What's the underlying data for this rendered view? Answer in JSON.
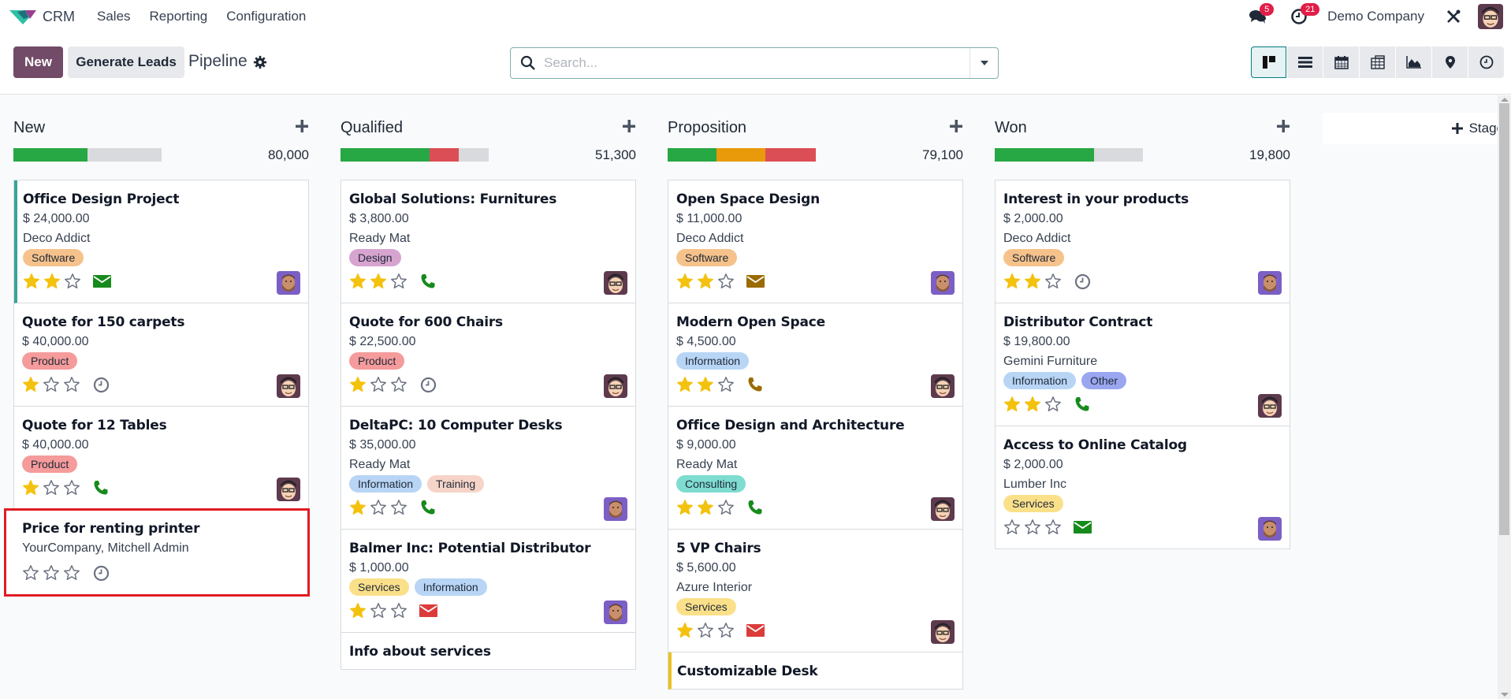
{
  "navbar": {
    "app_name": "CRM",
    "menu": [
      "Sales",
      "Reporting",
      "Configuration"
    ],
    "messages_count": "5",
    "activities_count": "21",
    "company": "Demo Company"
  },
  "control": {
    "new_label": "New",
    "generate_label": "Generate Leads",
    "title": "Pipeline",
    "search_placeholder": "Search...",
    "views": [
      "kanban",
      "list",
      "calendar",
      "pivot",
      "graph",
      "map",
      "activity"
    ],
    "active_view": "kanban"
  },
  "colors": {
    "brand": "#714b67",
    "green": "#28a745",
    "red": "#dc4e55",
    "orange": "#e89a0b",
    "grey": "#d8dadd"
  },
  "stage_add_label": "Stage",
  "columns": [
    {
      "title": "New",
      "total": "80,000",
      "progress": {
        "green": 0.5,
        "orange": 0,
        "red": 0
      },
      "cards": [
        {
          "title": "Office Design Project",
          "amount": "$ 24,000.00",
          "customer": "Deco Addict",
          "tags": [
            {
              "label": "Software",
              "color": "#f6c28b"
            }
          ],
          "stars": 2,
          "activity": "email",
          "activity_color": "#178a1c",
          "avatar": "bearded",
          "border": "teal"
        },
        {
          "title": "Quote for 150 carpets",
          "amount": "$ 40,000.00",
          "customer": "",
          "tags": [
            {
              "label": "Product",
              "color": "#f59b9b"
            }
          ],
          "stars": 1,
          "activity": "clock",
          "activity_color": "#6b7280",
          "avatar": "glasses",
          "border": ""
        },
        {
          "title": "Quote for 12 Tables",
          "amount": "$ 40,000.00",
          "customer": "",
          "tags": [
            {
              "label": "Product",
              "color": "#f59b9b"
            }
          ],
          "stars": 1,
          "activity": "phone",
          "activity_color": "#178a1c",
          "avatar": "glasses",
          "border": ""
        },
        {
          "title": "Price for renting printer",
          "amount": "",
          "customer": "YourCompany, Mitchell Admin",
          "tags": [],
          "stars": 0,
          "activity": "clock",
          "activity_color": "#6b7280",
          "avatar": "",
          "border": "",
          "highlight": true
        }
      ]
    },
    {
      "title": "Qualified",
      "total": "51,300",
      "progress": {
        "green": 0.6,
        "orange": 0,
        "red": 0.2
      },
      "cards": [
        {
          "title": "Global Solutions: Furnitures",
          "amount": "$ 3,800.00",
          "customer": "Ready Mat",
          "tags": [
            {
              "label": "Design",
              "color": "#d7a4d0"
            }
          ],
          "stars": 2,
          "activity": "phone",
          "activity_color": "#178a1c",
          "avatar": "glasses",
          "border": ""
        },
        {
          "title": "Quote for 600 Chairs",
          "amount": "$ 22,500.00",
          "customer": "",
          "tags": [
            {
              "label": "Product",
              "color": "#f59b9b"
            }
          ],
          "stars": 1,
          "activity": "clock",
          "activity_color": "#6b7280",
          "avatar": "glasses",
          "border": ""
        },
        {
          "title": "DeltaPC: 10 Computer Desks",
          "amount": "$ 35,000.00",
          "customer": "Ready Mat",
          "tags": [
            {
              "label": "Information",
              "color": "#b8d5f5"
            },
            {
              "label": "Training",
              "color": "#f6d4c8"
            }
          ],
          "stars": 1,
          "activity": "phone",
          "activity_color": "#178a1c",
          "avatar": "bearded",
          "border": ""
        },
        {
          "title": "Balmer Inc: Potential Distributor",
          "amount": "$ 1,000.00",
          "customer": "",
          "tags": [
            {
              "label": "Services",
              "color": "#fbe08a"
            },
            {
              "label": "Information",
              "color": "#b8d5f5"
            }
          ],
          "stars": 1,
          "activity": "email",
          "activity_color": "#dc3b3b",
          "avatar": "bearded",
          "border": ""
        },
        {
          "title": "Info about services",
          "amount": "",
          "customer": "",
          "tags": [],
          "stars": -1,
          "activity": "",
          "activity_color": "",
          "avatar": "",
          "border": ""
        }
      ]
    },
    {
      "title": "Proposition",
      "total": "79,100",
      "progress": {
        "green": 0.33,
        "orange": 0.33,
        "red": 0.34
      },
      "cards": [
        {
          "title": "Open Space Design",
          "amount": "$ 11,000.00",
          "customer": "Deco Addict",
          "tags": [
            {
              "label": "Software",
              "color": "#f6c28b"
            }
          ],
          "stars": 2,
          "activity": "email",
          "activity_color": "#9a6b00",
          "avatar": "bearded",
          "border": ""
        },
        {
          "title": "Modern Open Space",
          "amount": "$ 4,500.00",
          "customer": "",
          "tags": [
            {
              "label": "Information",
              "color": "#b8d5f5"
            }
          ],
          "stars": 2,
          "activity": "phone",
          "activity_color": "#9a6b00",
          "avatar": "glasses",
          "border": ""
        },
        {
          "title": "Office Design and Architecture",
          "amount": "$ 9,000.00",
          "customer": "Ready Mat",
          "tags": [
            {
              "label": "Consulting",
              "color": "#7fdcd0"
            }
          ],
          "stars": 2,
          "activity": "phone",
          "activity_color": "#178a1c",
          "avatar": "glasses",
          "border": ""
        },
        {
          "title": "5 VP Chairs",
          "amount": "$ 5,600.00",
          "customer": "Azure Interior",
          "tags": [
            {
              "label": "Services",
              "color": "#fbe08a"
            }
          ],
          "stars": 1,
          "activity": "email",
          "activity_color": "#dc3b3b",
          "avatar": "glasses",
          "border": ""
        },
        {
          "title": "Customizable Desk",
          "amount": "",
          "customer": "",
          "tags": [],
          "stars": -1,
          "activity": "",
          "activity_color": "",
          "avatar": "",
          "border": "yellow"
        }
      ]
    },
    {
      "title": "Won",
      "total": "19,800",
      "progress": {
        "green": 0.67,
        "orange": 0,
        "red": 0
      },
      "cards": [
        {
          "title": "Interest in your products",
          "amount": "$ 2,000.00",
          "customer": "Deco Addict",
          "tags": [
            {
              "label": "Software",
              "color": "#f6c28b"
            }
          ],
          "stars": 2,
          "activity": "clock",
          "activity_color": "#6b7280",
          "avatar": "bearded",
          "border": ""
        },
        {
          "title": "Distributor Contract",
          "amount": "$ 19,800.00",
          "customer": "Gemini Furniture",
          "tags": [
            {
              "label": "Information",
              "color": "#b8d5f5"
            },
            {
              "label": "Other",
              "color": "#9aa6ef"
            }
          ],
          "stars": 2,
          "activity": "phone",
          "activity_color": "#178a1c",
          "avatar": "glasses",
          "border": ""
        },
        {
          "title": "Access to Online Catalog",
          "amount": "$ 2,000.00",
          "customer": "Lumber Inc",
          "tags": [
            {
              "label": "Services",
              "color": "#fbe08a"
            }
          ],
          "stars": 0,
          "activity": "email",
          "activity_color": "#178a1c",
          "avatar": "bearded",
          "border": ""
        }
      ]
    }
  ]
}
